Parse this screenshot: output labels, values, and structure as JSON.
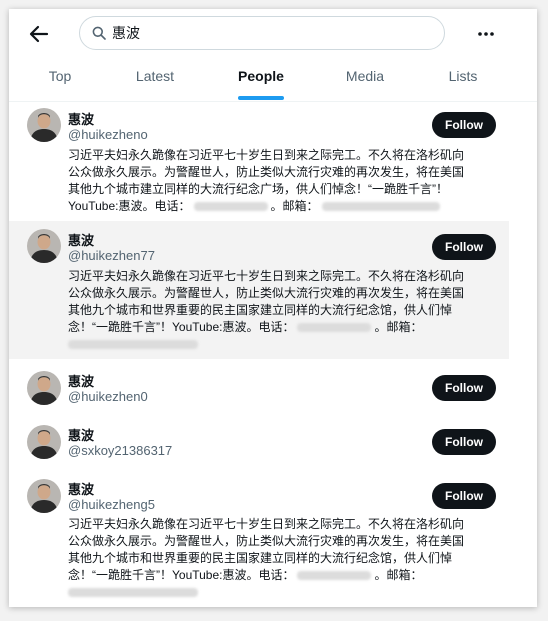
{
  "search": {
    "query": "惠波"
  },
  "tabs": [
    {
      "label": "Top"
    },
    {
      "label": "Latest"
    },
    {
      "label": "People",
      "active": true
    },
    {
      "label": "Media"
    },
    {
      "label": "Lists"
    }
  ],
  "follow_label": "Follow",
  "users": [
    {
      "name": "惠波",
      "handle": "@huikezheno",
      "bio": [
        "习近平夫妇永久跪像在习近平七十岁生日到来之际完工。不久将在洛杉矶向",
        "公众做永久展示。为警醒世人，防止类似大流行灾难的再次发生，将在美国",
        "其他九个城市建立同样的大流行纪念广场，供人们悼念！“一跪胜千言”！",
        "YouTube:惠波。电话：",
        "。邮箱："
      ]
    },
    {
      "name": "惠波",
      "handle": "@huikezhen77",
      "bio": [
        "习近平夫妇永久跪像在习近平七十岁生日到来之际完工。不久将在洛杉矶向",
        "公众做永久展示。为警醒世人，防止类似大流行灾难的再次发生，将在美国",
        "其他九个城市和世界重要的民主国家建立同样的大流行纪念馆，供人们悼",
        "念！“一跪胜千言”！YouTube:惠波。电话：",
        "。邮箱："
      ]
    },
    {
      "name": "惠波",
      "handle": "@huikezhen0"
    },
    {
      "name": "惠波",
      "handle": "@sxkoy21386317"
    },
    {
      "name": "惠波",
      "handle": "@huikezheng5",
      "bio": [
        "习近平夫妇永久跪像在习近平七十岁生日到来之际完工。不久将在洛杉矶向",
        "公众做永久展示。为警醒世人，防止类似大流行灾难的再次发生，将在美国",
        "其他九个城市和世界重要的民主国家建立同样的大流行纪念馆，供人们悼",
        "念！“一跪胜千言”！YouTube:惠波。电话：",
        "。邮箱："
      ]
    }
  ]
}
